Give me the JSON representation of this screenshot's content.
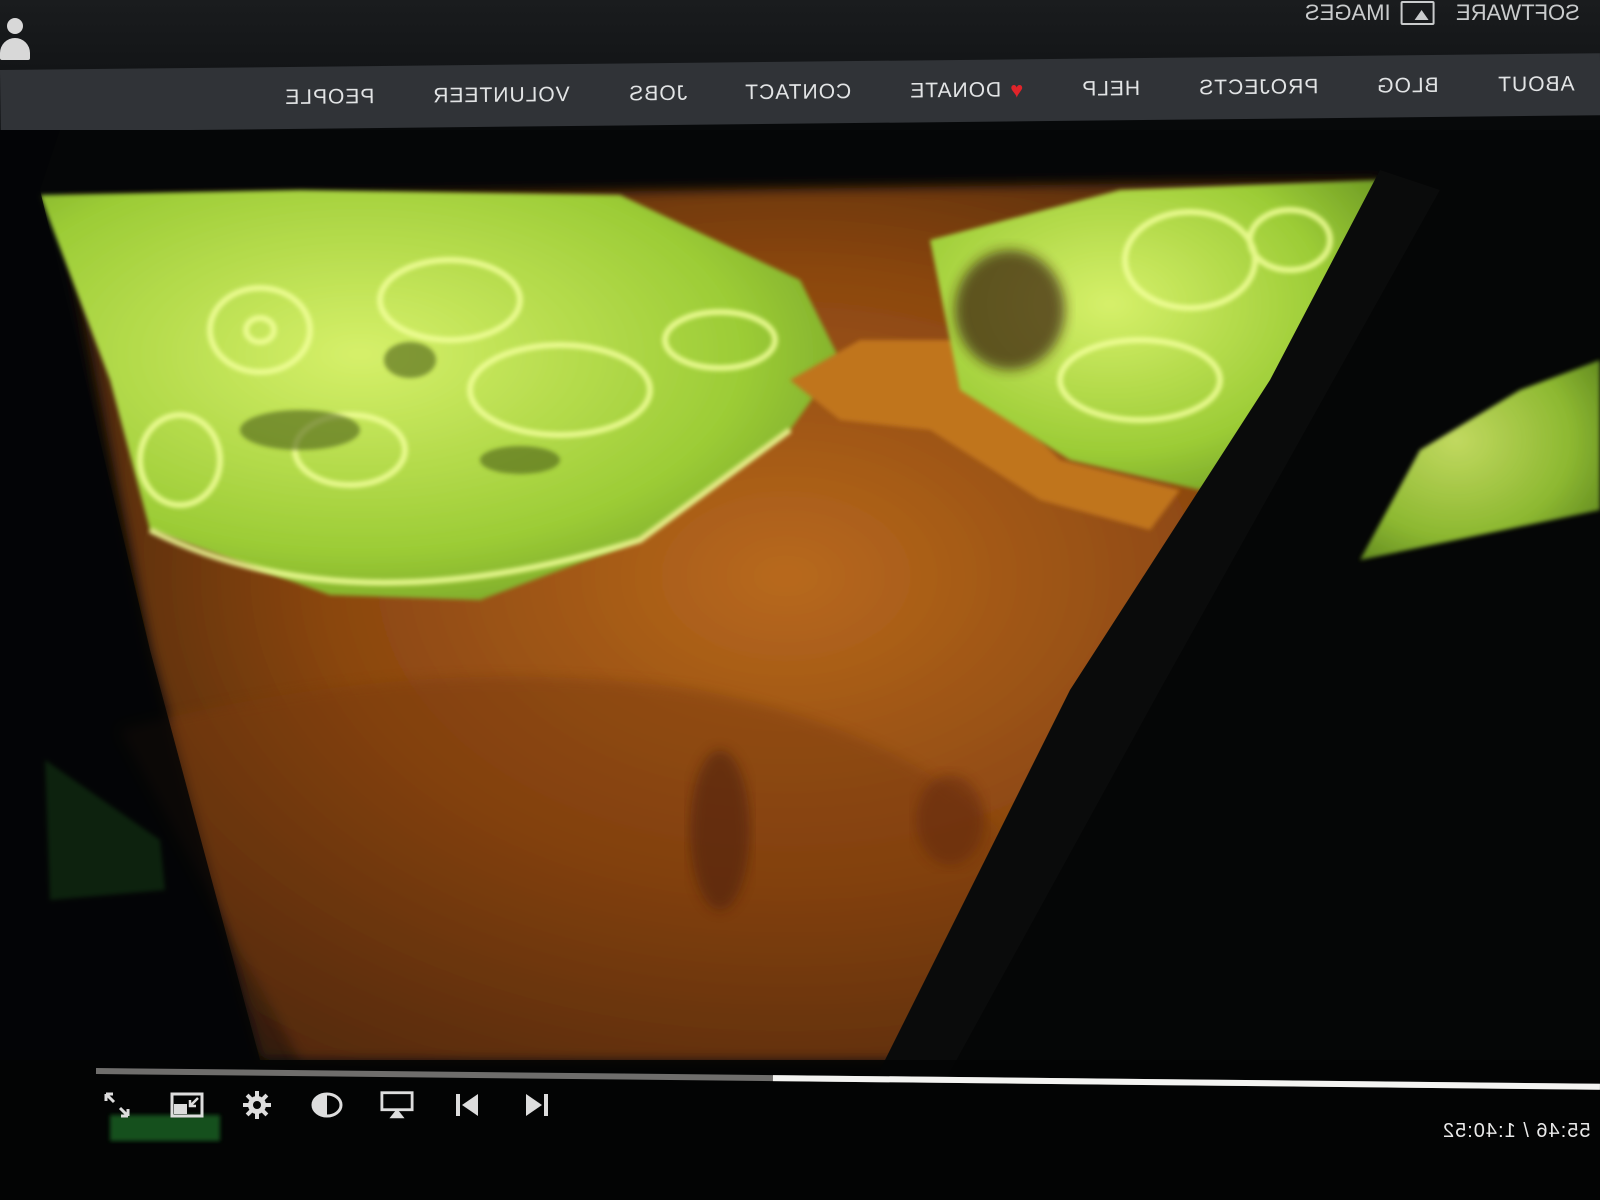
{
  "top": {
    "links": [
      {
        "label": "IMAGES",
        "icon": "image-icon"
      },
      {
        "label": "SOFTWARE"
      }
    ],
    "user_icon": "user-icon"
  },
  "nav": {
    "items": [
      {
        "label": "ABOUT"
      },
      {
        "label": "BLOG"
      },
      {
        "label": "PROJECTS"
      },
      {
        "label": "HELP"
      },
      {
        "label": "DONATE",
        "icon": "heart-icon"
      },
      {
        "label": "CONTACT"
      },
      {
        "label": "JOBS"
      },
      {
        "label": "VOLUNTEER"
      },
      {
        "label": "PEOPLE"
      }
    ]
  },
  "player": {
    "current_time": "55:46",
    "duration": "1:40:52",
    "time_display": "55:46 / 1:40:52",
    "progress_fraction": 0.55,
    "controls": [
      "fullscreen-icon",
      "picture-in-picture-icon",
      "settings-gear-icon",
      "contrast-icon",
      "airplay-icon",
      "previous-icon",
      "next-icon"
    ]
  },
  "colors": {
    "nav_bg": "#303337",
    "heart": "#e0242a",
    "lace_green": "#b9e04a",
    "skin_amber": "#a85a16"
  }
}
